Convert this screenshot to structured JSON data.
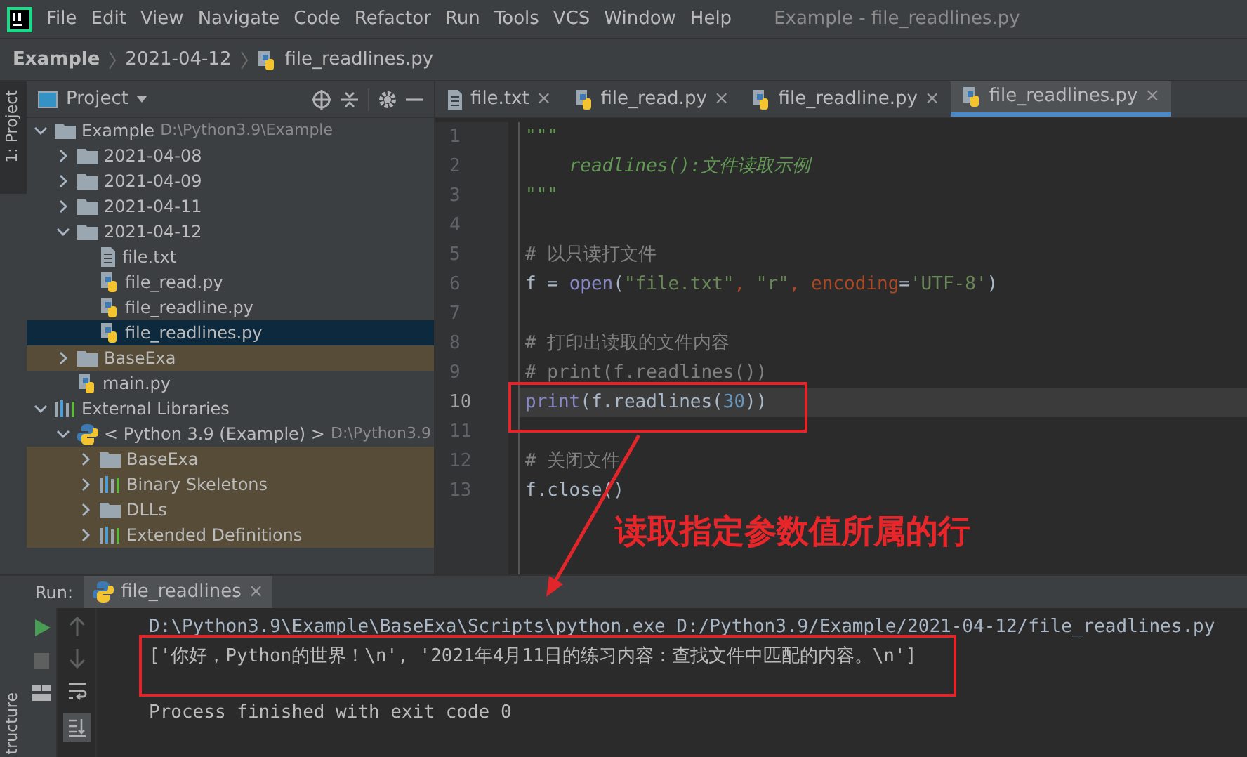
{
  "window": {
    "title": "Example - file_readlines.py"
  },
  "menu": [
    "File",
    "Edit",
    "View",
    "Navigate",
    "Code",
    "Refactor",
    "Run",
    "Tools",
    "VCS",
    "Window",
    "Help"
  ],
  "breadcrumb": [
    "Example",
    "2021-04-12",
    "file_readlines.py"
  ],
  "side_strip": {
    "top": "1: Project",
    "bottom": "tructure"
  },
  "project_panel": {
    "title": "Project",
    "tree": [
      {
        "label": "Example",
        "hint": "D:\\Python3.9\\Example",
        "kind": "folder",
        "expanded": true,
        "selected": false,
        "highlighted": false,
        "children": [
          {
            "label": "2021-04-08",
            "kind": "folder",
            "expanded": false,
            "selected": false,
            "highlighted": false
          },
          {
            "label": "2021-04-09",
            "kind": "folder",
            "expanded": false,
            "selected": false,
            "highlighted": false
          },
          {
            "label": "2021-04-11",
            "kind": "folder",
            "expanded": false,
            "selected": false,
            "highlighted": false
          },
          {
            "label": "2021-04-12",
            "kind": "folder",
            "expanded": true,
            "selected": false,
            "highlighted": false,
            "children": [
              {
                "label": "file.txt",
                "kind": "text",
                "selected": false,
                "highlighted": false
              },
              {
                "label": "file_read.py",
                "kind": "python",
                "selected": false,
                "highlighted": false
              },
              {
                "label": "file_readline.py",
                "kind": "python",
                "selected": false,
                "highlighted": false
              },
              {
                "label": "file_readlines.py",
                "kind": "python",
                "selected": true,
                "highlighted": false
              }
            ]
          },
          {
            "label": "BaseExa",
            "kind": "folder",
            "expanded": false,
            "selected": false,
            "highlighted": true
          },
          {
            "label": "main.py",
            "kind": "python",
            "selected": false,
            "highlighted": false
          }
        ]
      },
      {
        "label": "External Libraries",
        "kind": "library",
        "expanded": true,
        "selected": false,
        "highlighted": false,
        "children": [
          {
            "label": "< Python 3.9 (Example) >",
            "hint": "D:\\Python3.9",
            "kind": "sdk",
            "expanded": true,
            "selected": false,
            "highlighted": false,
            "children": [
              {
                "label": "BaseExa",
                "kind": "folder",
                "expanded": false,
                "selected": false,
                "highlighted": true
              },
              {
                "label": "Binary Skeletons",
                "kind": "library",
                "expanded": false,
                "selected": false,
                "highlighted": true
              },
              {
                "label": "DLLs",
                "kind": "folder",
                "expanded": false,
                "selected": false,
                "highlighted": true
              },
              {
                "label": "Extended Definitions",
                "kind": "library",
                "expanded": false,
                "selected": false,
                "highlighted": true
              }
            ]
          }
        ]
      }
    ]
  },
  "editor_tabs": [
    {
      "label": "file.txt",
      "kind": "text",
      "selected": false,
      "close": "×"
    },
    {
      "label": "file_read.py",
      "kind": "python",
      "selected": false,
      "close": "×"
    },
    {
      "label": "file_readline.py",
      "kind": "python",
      "selected": false,
      "close": "×"
    },
    {
      "label": "file_readlines.py",
      "kind": "python",
      "selected": true,
      "close": "×"
    }
  ],
  "code_lines": [
    {
      "number": "1",
      "current": false,
      "tokens": [
        {
          "kind": "doc",
          "text": "\"\"\""
        }
      ]
    },
    {
      "number": "2",
      "current": false,
      "tokens": [
        {
          "kind": "doc",
          "text": "    readlines():文件读取示例"
        }
      ]
    },
    {
      "number": "3",
      "current": false,
      "tokens": [
        {
          "kind": "doc",
          "text": "\"\"\""
        }
      ]
    },
    {
      "number": "4",
      "current": false
    },
    {
      "number": "5",
      "current": false,
      "tokens": [
        {
          "kind": "comment",
          "text": "# 以只读打文件"
        }
      ]
    },
    {
      "number": "6",
      "current": false,
      "tokens": [
        {
          "kind": "plain",
          "text": "f = "
        },
        {
          "kind": "builtin",
          "text": "open"
        },
        {
          "kind": "plain",
          "text": "("
        },
        {
          "kind": "string",
          "text": "\"file.txt\""
        },
        {
          "kind": "param",
          "text": ", "
        },
        {
          "kind": "string",
          "text": "\"r\""
        },
        {
          "kind": "param",
          "text": ", encoding"
        },
        {
          "kind": "plain",
          "text": "="
        },
        {
          "kind": "string",
          "text": "'UTF-8'"
        },
        {
          "kind": "plain",
          "text": ")"
        }
      ]
    },
    {
      "number": "7",
      "current": false
    },
    {
      "number": "8",
      "current": false,
      "tokens": [
        {
          "kind": "comment",
          "text": "# 打印出读取的文件内容"
        }
      ]
    },
    {
      "number": "9",
      "current": false,
      "tokens": [
        {
          "kind": "comment",
          "text": "# print(f.readlines())"
        }
      ]
    },
    {
      "number": "10",
      "current": true,
      "tokens": [
        {
          "kind": "builtin",
          "text": "print"
        },
        {
          "kind": "plain",
          "text": "(f.readlines("
        },
        {
          "kind": "number",
          "text": "30"
        },
        {
          "kind": "plain",
          "text": "))"
        }
      ]
    },
    {
      "number": "11",
      "current": false
    },
    {
      "number": "12",
      "current": false,
      "tokens": [
        {
          "kind": "comment",
          "text": "# 关闭文件"
        }
      ]
    },
    {
      "number": "13",
      "current": false,
      "tokens": [
        {
          "kind": "plain",
          "text": "f.close()"
        }
      ]
    }
  ],
  "annotation": "读取指定参数值所属的行",
  "run_panel": {
    "label": "Run:",
    "tab": "file_readlines",
    "tab_close": "×",
    "output": [
      {
        "kind": "command",
        "text": "D:\\Python3.9\\Example\\BaseExa\\Scripts\\python.exe D:/Python3.9/Example/2021-04-12/file_readlines.py"
      },
      {
        "kind": "result",
        "text": "['你好，Python的世界！\\n', '2021年4月11日的练习内容：查找文件中匹配的内容。\\n']"
      },
      {
        "kind": "status",
        "text": "Process finished with exit code 0"
      }
    ]
  }
}
